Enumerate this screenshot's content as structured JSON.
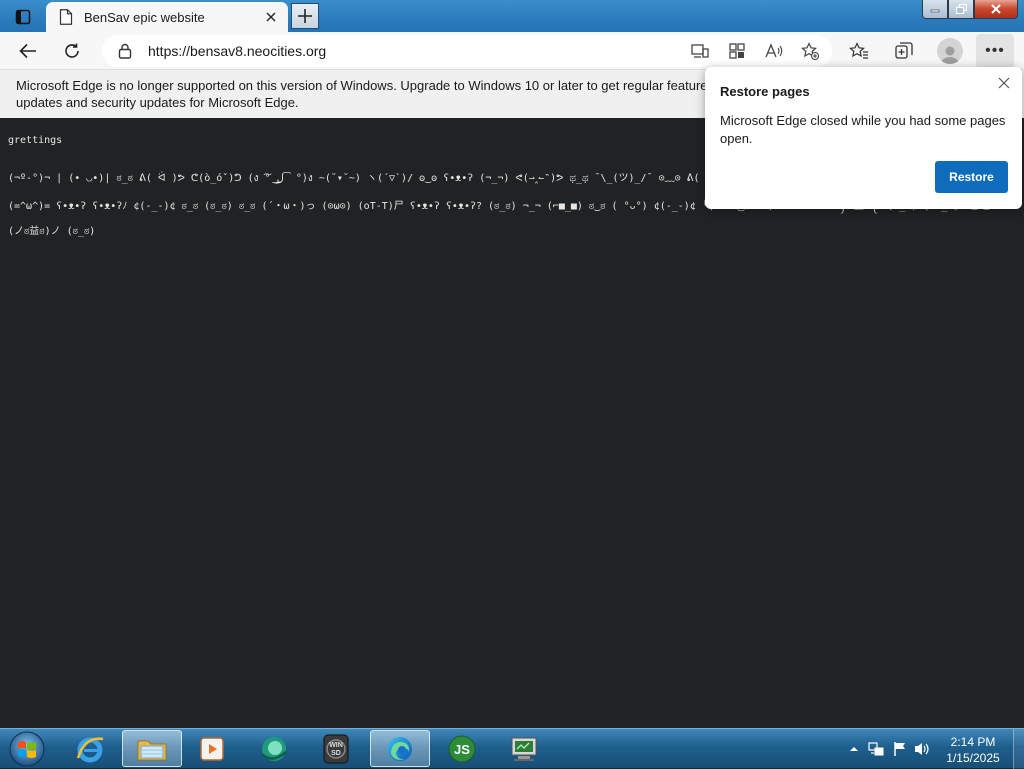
{
  "browser": {
    "tab": {
      "title": "BenSav epic website"
    },
    "address_bar": {
      "url": "https://bensav8.neocities.org"
    }
  },
  "infobar": {
    "message": "Microsoft Edge is no longer supported on this version of Windows. Upgrade to Windows 10 or later to get regular feature updates and security updates for Microsoft Edge."
  },
  "page": {
    "greeting": "grettings",
    "lines": [
      "(¬º-°)¬ | (• ◡•)| ಠ_ಠ ᕕ( ᐛ )ᕗ ᕦ(ò_óˇ)ᕤ (ง ͠° ͟ل͜ ͡°)ง ~(˘▾˘~) ヽ(´▽`)/ ʘ‿ʘ ʕ•ᴥ•ʔ (¬_¬) ᕙ(⇀‸↼‶)ᕗ ಥ_ಥ ¯\\_(ツ)_/¯ ⊙﹏⊙ ᕕ( ᐛ )ᕗ (✿◠‿◠) ٩(◕‿◕)۶ ლ(ಠ益ಠლ) (づ｡◕‿‿◕｡)づ",
      "(=^ω^)= ʕ•ᴥ•ʔ ʕ•ᴥ•ʔﾉ ¢(-_-)¢ ಠ_ಠ (ಠ_ಠ) ಠ_ಠ (´・ω・)っ (⊙ω⊙) (oT-T)尸 ʕ•ᴥ•ʔ ʕ•ᴥ•ʔ? (ಠ_ಠ) ¬_¬ (⌐■_■) ಠ‿ಠ ( °ᴗ°) ¢(-_-)¢ ╰( ͡° ͜ʖ ͡° )つ──☆*:・ﾟ ୧༼ಠ益ಠ༽୨ (•_•) ( •_•)>⌐■-■",
      "(ノಠ益ಠ)ノ (ಠ_ಠ)"
    ]
  },
  "popup": {
    "title": "Restore pages",
    "message": "Microsoft Edge closed while you had some pages open.",
    "button": "Restore"
  },
  "taskbar": {
    "apps": [
      "Internet Explorer",
      "Windows Explorer",
      "Media Player",
      "Green App",
      "WinSD",
      "Microsoft Edge",
      "JS",
      "Network Tool"
    ],
    "time": "2:14 PM",
    "date": "1/15/2025"
  },
  "colors": {
    "accent": "#0f6cbd",
    "page_background": "#202324",
    "taskbar": "#1f5f8e"
  }
}
